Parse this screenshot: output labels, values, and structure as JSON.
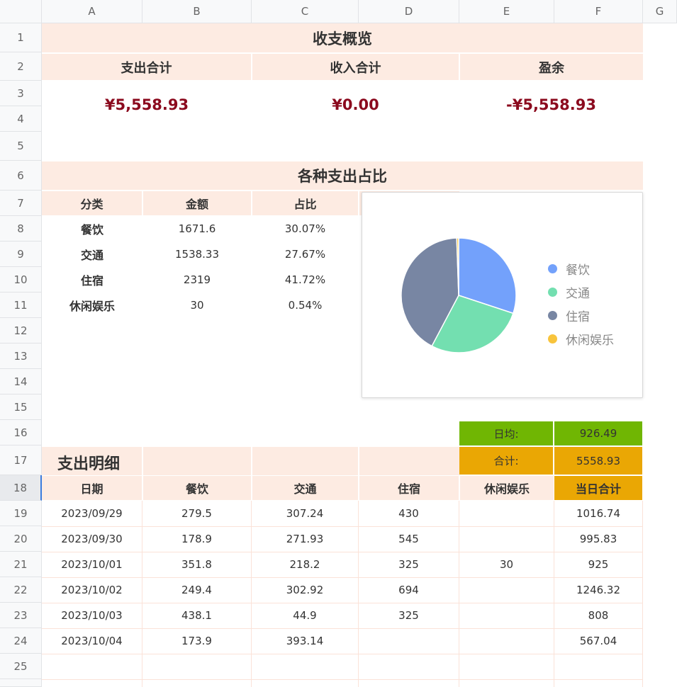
{
  "columns": [
    "A",
    "B",
    "C",
    "D",
    "E",
    "F",
    "G"
  ],
  "rows": [
    "1",
    "2",
    "3",
    "4",
    "5",
    "6",
    "7",
    "8",
    "9",
    "10",
    "11",
    "12",
    "13",
    "14",
    "15",
    "16",
    "17",
    "18",
    "19",
    "20",
    "21",
    "22",
    "23",
    "24",
    "25"
  ],
  "overview": {
    "title": "收支概览",
    "labels": [
      "支出合计",
      "收入合计",
      "盈余"
    ],
    "values": [
      "¥5,558.93",
      "¥0.00",
      "-¥5,558.93"
    ]
  },
  "share": {
    "title": "各种支出占比",
    "headers": [
      "分类",
      "金额",
      "占比"
    ],
    "rows": [
      {
        "cat": "餐饮",
        "amount": "1671.6",
        "pct": "30.07%"
      },
      {
        "cat": "交通",
        "amount": "1538.33",
        "pct": "27.67%"
      },
      {
        "cat": "住宿",
        "amount": "2319",
        "pct": "41.72%"
      },
      {
        "cat": "休闲娱乐",
        "amount": "30",
        "pct": "0.54%"
      }
    ]
  },
  "chart_data": {
    "type": "pie",
    "categories": [
      "餐饮",
      "交通",
      "住宿",
      "休闲娱乐"
    ],
    "values": [
      1671.6,
      1538.33,
      2319,
      30
    ],
    "colors": [
      "#73a1fb",
      "#73dfb0",
      "#7886a3",
      "#f8c43c"
    ],
    "legend": "right"
  },
  "summary": {
    "daily_avg_label": "日均:",
    "daily_avg_value": "926.49",
    "total_label": "合计:",
    "total_value": "5558.93",
    "daily_avg_color": "#70b603",
    "total_color": "#eaa704"
  },
  "detail": {
    "title": "支出明细",
    "headers": [
      "日期",
      "餐饮",
      "交通",
      "住宿",
      "休闲娱乐",
      "当日合计"
    ],
    "rows": [
      [
        "2023/09/29",
        "279.5",
        "307.24",
        "430",
        "",
        "1016.74"
      ],
      [
        "2023/09/30",
        "178.9",
        "271.93",
        "545",
        "",
        "995.83"
      ],
      [
        "2023/10/01",
        "351.8",
        "218.2",
        "325",
        "30",
        "925"
      ],
      [
        "2023/10/02",
        "249.4",
        "302.92",
        "694",
        "",
        "1246.32"
      ],
      [
        "2023/10/03",
        "438.1",
        "44.9",
        "325",
        "",
        "808"
      ],
      [
        "2023/10/04",
        "173.9",
        "393.14",
        "",
        "",
        "567.04"
      ]
    ]
  }
}
